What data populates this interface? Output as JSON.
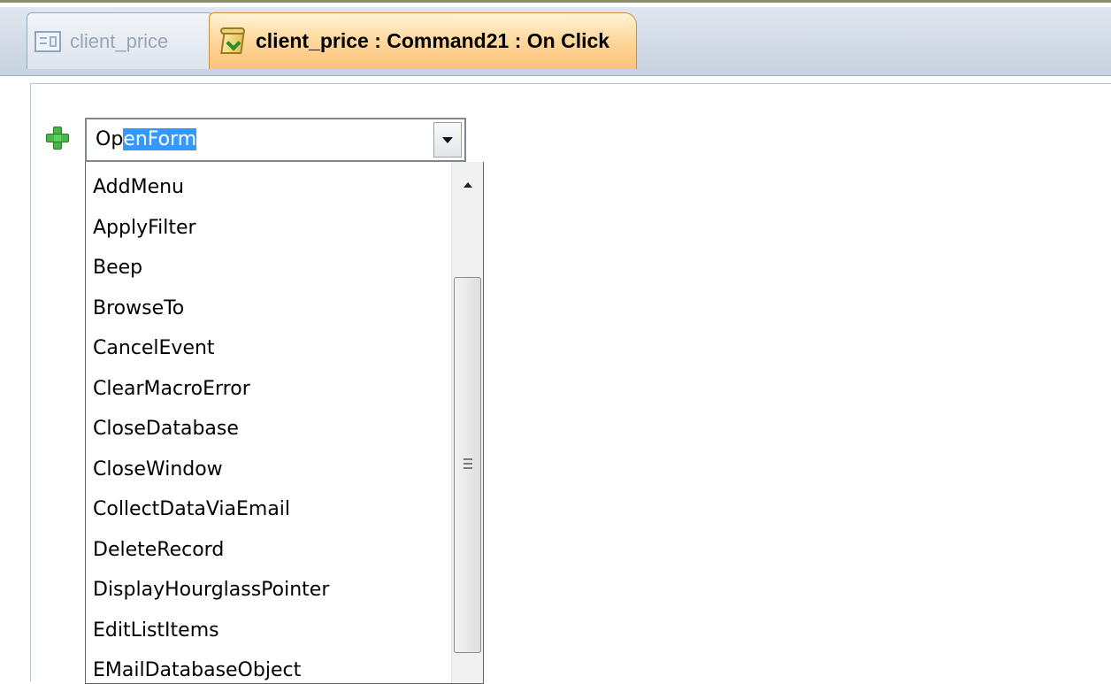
{
  "tabs": [
    {
      "label": "client_price",
      "icon": "form-icon",
      "active": false
    },
    {
      "label": "client_price : Command21 : On Click",
      "icon": "macro-icon",
      "active": true
    }
  ],
  "macro": {
    "combo": {
      "value_prefix": "Op",
      "value_selected": "enForm",
      "full_value": "OpenForm"
    },
    "dropdown_items": [
      "AddMenu",
      "ApplyFilter",
      "Beep",
      "BrowseTo",
      "CancelEvent",
      "ClearMacroError",
      "CloseDatabase",
      "CloseWindow",
      "CollectDataViaEmail",
      "DeleteRecord",
      "DisplayHourglassPointer",
      "EditListItems",
      "EMailDatabaseObject"
    ]
  },
  "colors": {
    "active_tab": "#ffd79c",
    "selection": "#3399ff",
    "add_icon": "#49b649"
  }
}
